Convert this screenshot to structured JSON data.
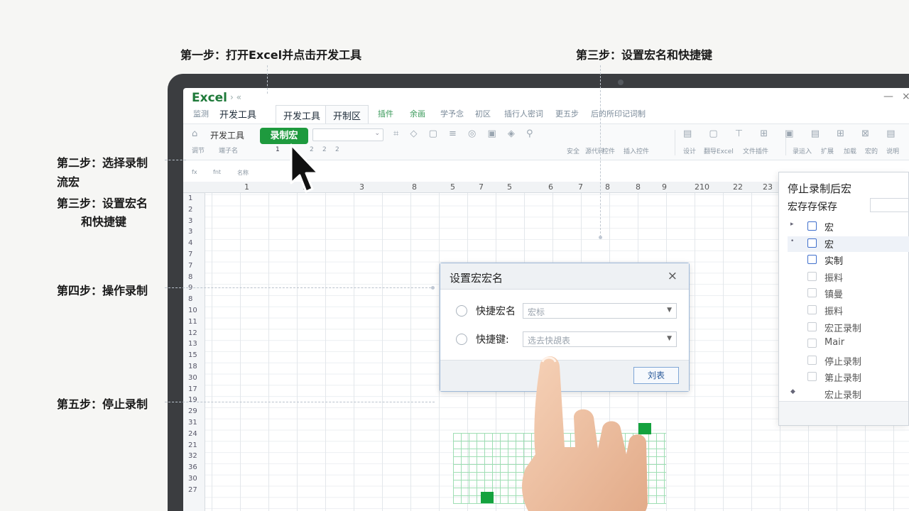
{
  "steps": {
    "step1": "第一步：打开Excel并点击开发工具",
    "step3_top": "第三步：设置宏名和快捷键",
    "step2_line1": "第二步：选择录制",
    "step2_line2": "流宏",
    "step3_line1": "第三步：设置宏名",
    "step3_line2": "和快捷键",
    "step4": "第四步：操作录制",
    "step5": "第五步：停止录制"
  },
  "app": {
    "title": "Excel",
    "title_arrows": "› «",
    "tabs": [
      "监测",
      "开发工具",
      "开发工具",
      "开制区",
      "插件",
      "余画",
      "学予念",
      "初区",
      "插行人密词",
      "更五步",
      "后的所印记词制"
    ],
    "window_controls": [
      "—",
      "×"
    ]
  },
  "ribbon": {
    "dev_tools": "开发工具",
    "home_icon": "home-icon",
    "record_macro": "录制宏",
    "sub_labels": [
      "调节",
      "端子名"
    ],
    "numbers": [
      "1",
      "2",
      "2",
      "2"
    ],
    "right_labels": [
      "安全",
      "源代码",
      "控件",
      "插入控件"
    ],
    "far_labels": [
      "设计",
      "翻导Excel",
      "文件插件",
      "录运入",
      "扩展",
      "加载",
      "宏的",
      "说明"
    ]
  },
  "formula": [
    "fx",
    "fnt",
    "名称"
  ],
  "columns": [
    "1",
    "1",
    "3",
    "8",
    "5",
    "7",
    "5",
    "6",
    "7",
    "8",
    "8",
    "9",
    "210",
    "22",
    "23"
  ],
  "rows": [
    "1",
    "2",
    "3",
    "3",
    "4",
    "7",
    "7",
    "8",
    "9",
    "8",
    "10",
    "11",
    "12",
    "13",
    "15",
    "18",
    "30",
    "17",
    "19",
    "29",
    "31",
    "24",
    "21",
    "32",
    "36",
    "30",
    "27"
  ],
  "dialog": {
    "title": "设置宏宏名",
    "close": "×",
    "row1_label": "快捷宏名",
    "row1_value": "宏标",
    "row2_label": "快捷键:",
    "row2_value": "选去快覘表",
    "ok_button": "刘表"
  },
  "panel": {
    "title": "停止录制后宏",
    "subtitle": "宏存存保存",
    "items": [
      {
        "mark": "▸",
        "label": "宏",
        "checkbox": "blue",
        "highlight": false
      },
      {
        "mark": "•",
        "label": "宏",
        "checkbox": "blue",
        "highlight": true
      },
      {
        "mark": "",
        "label": "实制",
        "checkbox": "blue",
        "highlight": false
      },
      {
        "mark": "",
        "label": "振料",
        "checkbox": "gray",
        "highlight": false
      },
      {
        "mark": "",
        "label": "镇曼",
        "checkbox": "gray",
        "highlight": false
      },
      {
        "mark": "",
        "label": "振料",
        "checkbox": "gray",
        "highlight": false
      },
      {
        "mark": "",
        "label": "宏正录制",
        "checkbox": "gray",
        "highlight": false
      },
      {
        "mark": "",
        "label": "Mair",
        "checkbox": "gray",
        "highlight": false
      },
      {
        "mark": "",
        "label": "停止录制",
        "checkbox": "gray",
        "highlight": false
      },
      {
        "mark": "",
        "label": "第止录制",
        "checkbox": "gray",
        "highlight": false
      },
      {
        "mark": "◆",
        "label": "宏止录制",
        "checkbox": "none",
        "highlight": false
      }
    ]
  },
  "colors": {
    "excel_green": "#1e9a3e",
    "dialog_border": "#9db8d8"
  }
}
